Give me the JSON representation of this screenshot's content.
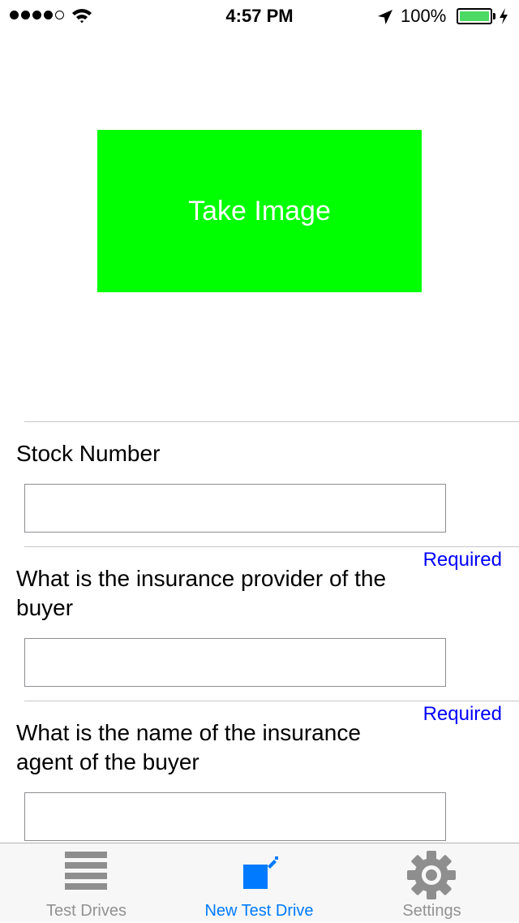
{
  "status_bar": {
    "time": "4:57 PM",
    "battery": "100%",
    "signal_dots_filled": 4,
    "signal_dots_total": 5,
    "battery_color": "#4cd964"
  },
  "take_image": {
    "label": "Take Image",
    "color": "#00ff00"
  },
  "form": {
    "fields": [
      {
        "label": "Stock Number",
        "value": "",
        "required_label": ""
      },
      {
        "label": "What is the insurance provider of the buyer",
        "value": "",
        "required_label": "Required"
      },
      {
        "label": "What is the name of the insurance agent of the buyer",
        "value": "",
        "required_label": "Required"
      }
    ],
    "required_color": "#0000ff"
  },
  "tab_bar": {
    "tabs": [
      {
        "label": "Test Drives",
        "icon": "list-icon",
        "active": false
      },
      {
        "label": "New Test Drive",
        "icon": "new-test-drive-icon",
        "active": true
      },
      {
        "label": "Settings",
        "icon": "gear-icon",
        "active": false
      }
    ],
    "active_color": "#007aff",
    "inactive_color": "#929292"
  }
}
